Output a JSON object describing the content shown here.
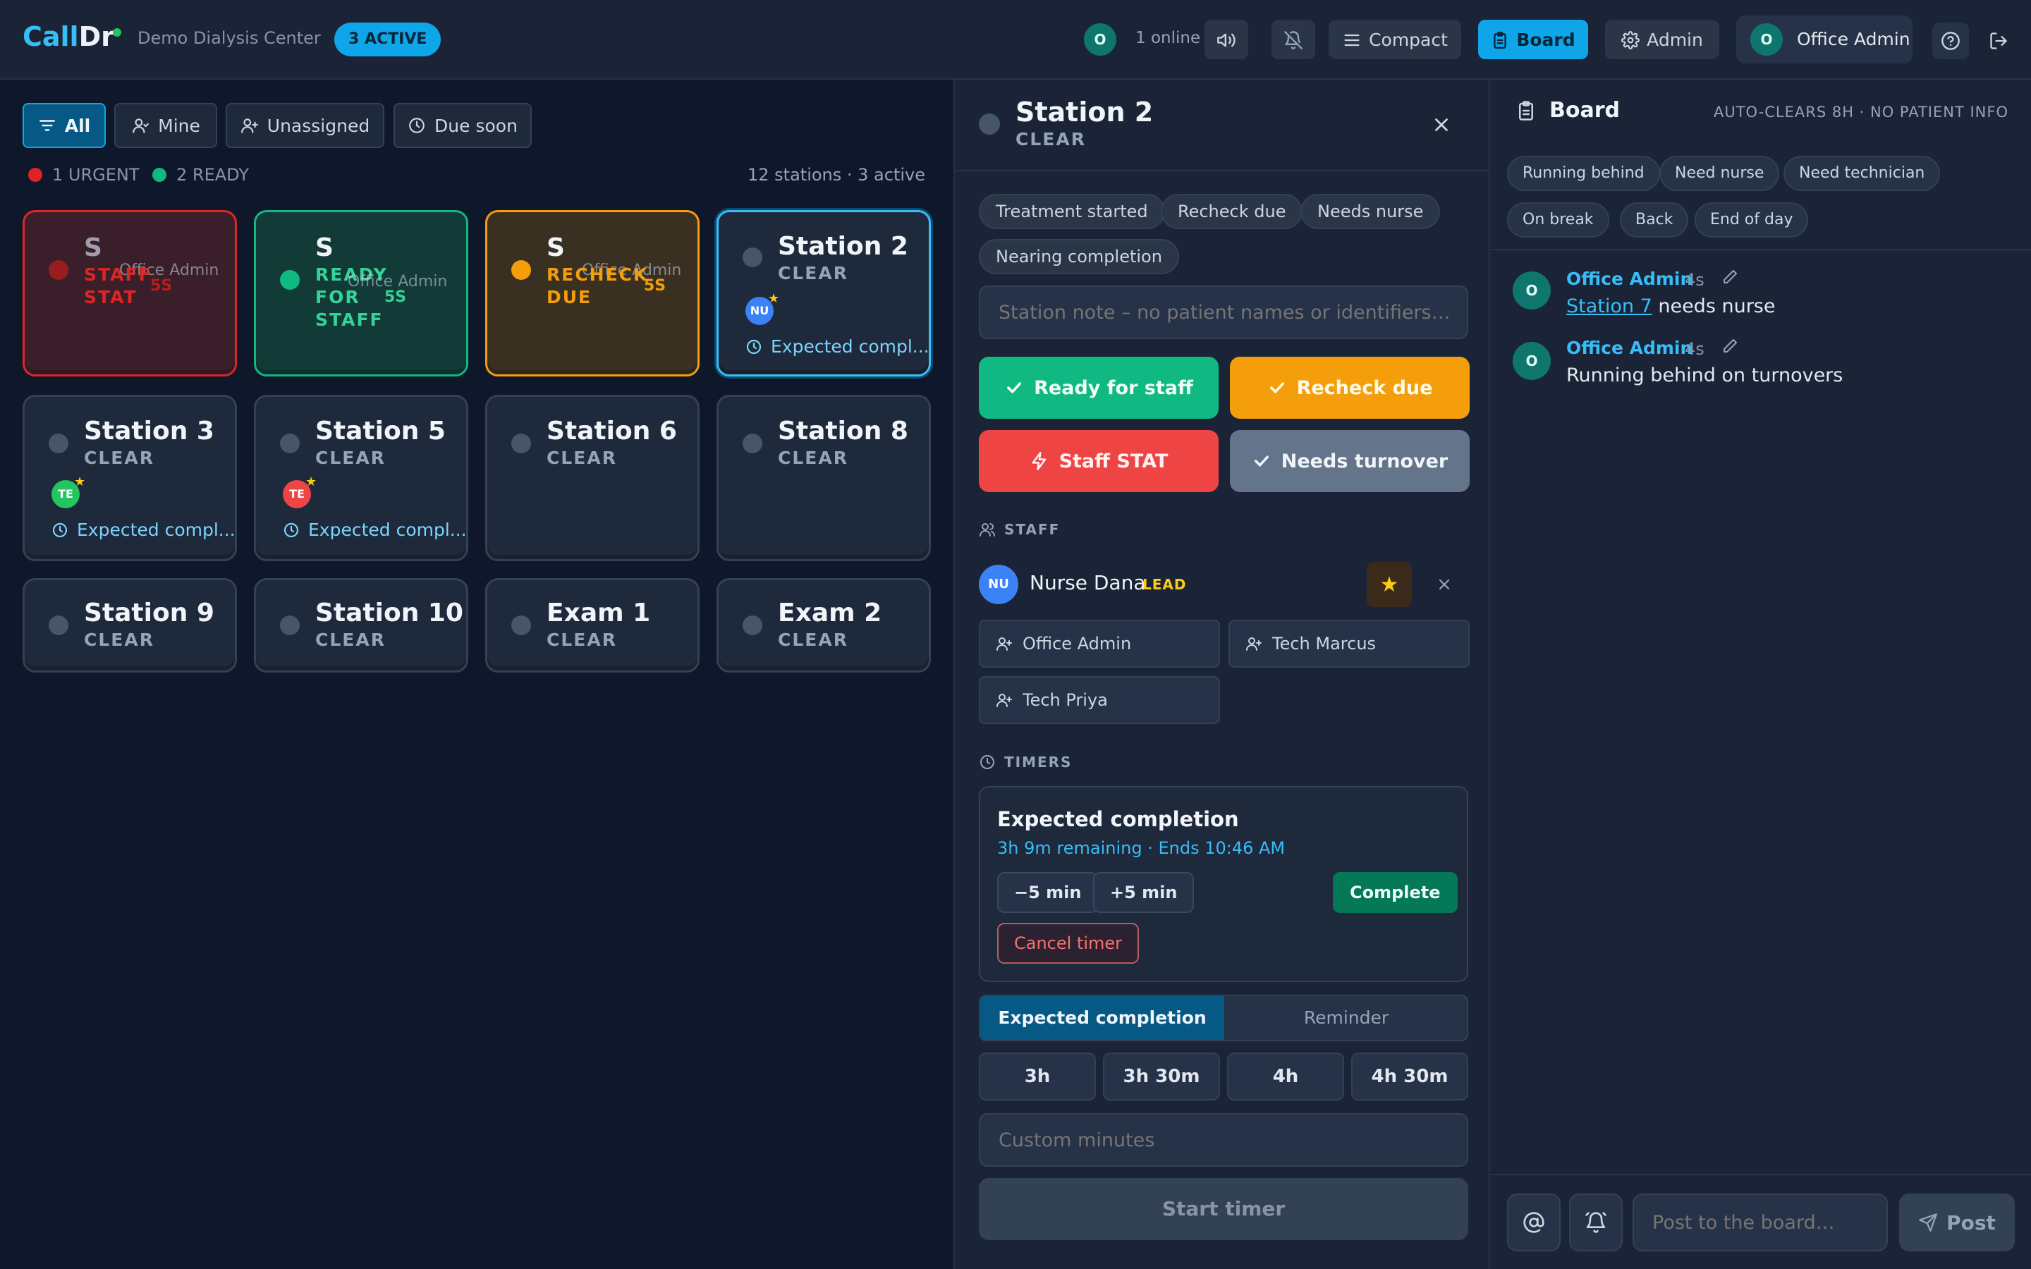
{
  "app": {
    "logo_call": "Call",
    "logo_dr": "Dr",
    "center_name": "Demo Dialysis Center",
    "active_badge": "3 ACTIVE"
  },
  "topbar": {
    "online_avatar": "O",
    "online_label": "1 online",
    "compact_label": "Compact",
    "board_label": "Board",
    "admin_label": "Admin",
    "user_avatar": "O",
    "user_name": "Office Admin"
  },
  "filters": {
    "all": "All",
    "mine": "Mine",
    "unassigned": "Unassigned",
    "due_soon": "Due soon",
    "legend_urgent": "1 URGENT",
    "legend_ready": "2 READY",
    "counts": "12 stations · 3 active"
  },
  "cards": {
    "c1": {
      "title": "S",
      "status_l1": "STAFF",
      "status_l2": "STAT",
      "owner": "Office Admin",
      "age": "5S"
    },
    "c2": {
      "title": "S",
      "status_l1": "READY",
      "status_l2": "FOR",
      "status_l3": "STAFF",
      "owner": "Office Admin",
      "age": "5S"
    },
    "c3": {
      "title": "S",
      "status_l1": "RECHECK",
      "status_l2": "DUE",
      "owner": "Office Admin",
      "age": "5S"
    },
    "c4": {
      "title": "Station 2",
      "status": "CLEAR",
      "avatar": "NU",
      "timer": "Expected compl..."
    },
    "c5": {
      "title": "Station 3",
      "status": "CLEAR",
      "avatar": "TE",
      "timer": "Expected compl..."
    },
    "c6": {
      "title": "Station 5",
      "status": "CLEAR",
      "avatar": "TE",
      "timer": "Expected compl..."
    },
    "c7": {
      "title": "Station 6",
      "status": "CLEAR"
    },
    "c8": {
      "title": "Station 8",
      "status": "CLEAR"
    },
    "c9": {
      "title": "Station 9",
      "status": "CLEAR"
    },
    "c10": {
      "title": "Station 10",
      "status": "CLEAR"
    },
    "c11": {
      "title": "Exam 1",
      "status": "CLEAR"
    },
    "c12": {
      "title": "Exam 2",
      "status": "CLEAR"
    }
  },
  "detail": {
    "title": "Station 2",
    "status": "CLEAR",
    "chips": [
      "Treatment started",
      "Recheck due",
      "Needs nurse",
      "Nearing completion"
    ],
    "note_placeholder": "Station note – no patient names or identifiers…",
    "actions": {
      "ready": "Ready for staff",
      "recheck": "Recheck due",
      "stat": "Staff STAT",
      "turnover": "Needs turnover"
    },
    "staff_heading": "STAFF",
    "staff_avatar": "NU",
    "staff_name": "Nurse Dana",
    "lead_badge": "LEAD",
    "assign": [
      "Office Admin",
      "Tech Marcus",
      "Tech Priya"
    ],
    "timers_heading": "TIMERS",
    "timer_title": "Expected completion",
    "timer_sub": "3h 9m remaining · Ends 10:46 AM",
    "minus5": "−5 min",
    "plus5": "+5 min",
    "complete": "Complete",
    "cancel": "Cancel timer",
    "seg_expected": "Expected completion",
    "seg_reminder": "Reminder",
    "durations": [
      "3h",
      "3h 30m",
      "4h",
      "4h 30m"
    ],
    "custom_placeholder": "Custom minutes",
    "start": "Start timer"
  },
  "board": {
    "title": "Board",
    "note": "AUTO-CLEARS 8H · NO PATIENT INFO",
    "chips": [
      "Running behind",
      "Need nurse",
      "Need technician",
      "On break",
      "Back",
      "End of day"
    ],
    "messages": [
      {
        "avatar": "O",
        "author": "Office Admin",
        "time": "4s",
        "link": "Station 7",
        "text": " needs nurse"
      },
      {
        "avatar": "O",
        "author": "Office Admin",
        "time": "4s",
        "text": "Running behind on turnovers"
      }
    ],
    "post_placeholder": "Post to the board…",
    "post_label": "Post"
  },
  "colors": {
    "accent": "#0ea5e9",
    "urgent": "#dc2626",
    "ready": "#10b981",
    "recheck": "#f59e0b",
    "stat_button": "#ef4444",
    "ready_button": "#10b981",
    "recheck_button": "#f59e0b",
    "turnover_button": "#64748b"
  },
  "icons": [
    "filter-icon",
    "user-icon",
    "user-plus-icon",
    "clock-icon",
    "volume-icon",
    "bell-off-icon",
    "menu-icon",
    "clipboard-icon",
    "gear-icon",
    "help-icon",
    "logout-icon",
    "close-icon",
    "check-icon",
    "bolt-icon",
    "star-icon",
    "at-icon",
    "bell-ring-icon",
    "send-icon",
    "pencil-icon"
  ]
}
